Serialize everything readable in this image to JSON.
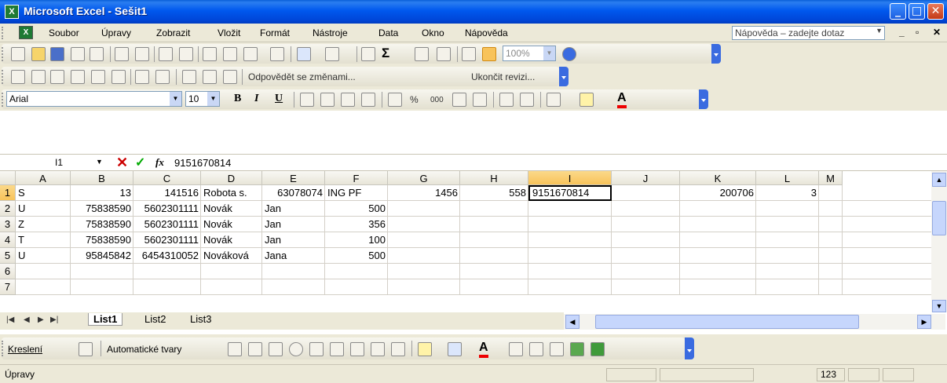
{
  "window": {
    "title": "Microsoft Excel - Sešit1",
    "app_icon": "excel-icon"
  },
  "menu": {
    "items": [
      "Soubor",
      "Úpravy",
      "Zobrazit",
      "Vložit",
      "Formát",
      "Nástroje",
      "Data",
      "Okno",
      "Nápověda"
    ],
    "help_placeholder": "Nápověda – zadejte dotaz"
  },
  "toolbar_standard": {
    "zoom": "100%"
  },
  "toolbar_review": {
    "reply_label": "Odpovědět se změnami...",
    "end_review_label": "Ukončit revizi..."
  },
  "toolbar_format": {
    "font_name": "Arial",
    "font_size": "10",
    "bold": "B",
    "italic": "I",
    "underline": "U",
    "percent": "%",
    "thousands": "000"
  },
  "formula_bar": {
    "name_box": "I1",
    "content": "9151670814",
    "fx": "fx"
  },
  "columns": [
    "A",
    "B",
    "C",
    "D",
    "E",
    "F",
    "G",
    "H",
    "I",
    "J",
    "K",
    "L",
    "M"
  ],
  "selected_column": "I",
  "rows": [
    {
      "n": "1",
      "cells": {
        "A": "S",
        "B": "13",
        "C": "141516",
        "D": "Robota s.",
        "E": "63078074",
        "F": "ING PF",
        "G": "1456",
        "H": "558",
        "I": "9151670814",
        "K": "200706",
        "L": "3"
      }
    },
    {
      "n": "2",
      "cells": {
        "A": "U",
        "B": "75838590",
        "C": "5602301111",
        "D": "Novák",
        "E": "Jan",
        "F": "500"
      }
    },
    {
      "n": "3",
      "cells": {
        "A": "Z",
        "B": "75838590",
        "C": "5602301111",
        "D": "Novák",
        "E": "Jan",
        "F": "356"
      }
    },
    {
      "n": "4",
      "cells": {
        "A": "T",
        "B": "75838590",
        "C": "5602301111",
        "D": "Novák",
        "E": "Jan",
        "F": "100"
      }
    },
    {
      "n": "5",
      "cells": {
        "A": "U",
        "B": "95845842",
        "C": "6454310052",
        "D": "Nováková",
        "E": "Jana",
        "F": "500"
      }
    },
    {
      "n": "6",
      "cells": {}
    },
    {
      "n": "7",
      "cells": {}
    }
  ],
  "sheet_tabs": [
    "List1",
    "List2",
    "List3"
  ],
  "active_sheet": "List1",
  "drawing_toolbar": {
    "draw_label": "Kreslení",
    "autoshapes_label": "Automatické tvary"
  },
  "status": {
    "mode": "Úpravy",
    "num_indicator": "123"
  }
}
